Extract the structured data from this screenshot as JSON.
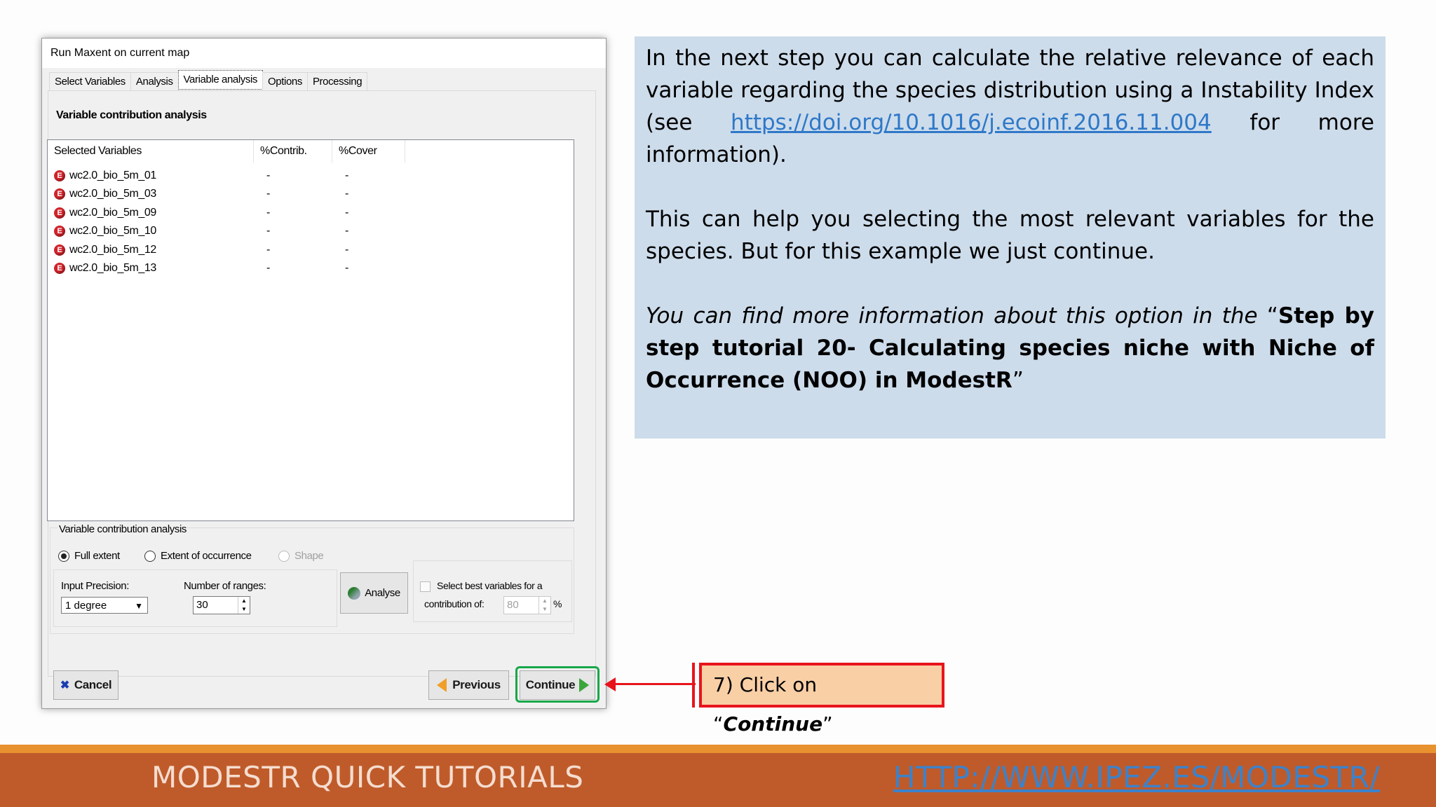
{
  "dialog": {
    "title": "Run Maxent on current map",
    "tabs": [
      "Select Variables",
      "Analysis",
      "Variable analysis",
      "Options",
      "Processing"
    ],
    "section_title": "Variable contribution analysis",
    "columns": [
      "Selected Variables",
      "%Contrib.",
      "%Cover"
    ],
    "rows": [
      {
        "name": "wc2.0_bio_5m_01",
        "contrib": "-",
        "cover": "-"
      },
      {
        "name": "wc2.0_bio_5m_03",
        "contrib": "-",
        "cover": "-"
      },
      {
        "name": "wc2.0_bio_5m_09",
        "contrib": "-",
        "cover": "-"
      },
      {
        "name": "wc2.0_bio_5m_10",
        "contrib": "-",
        "cover": "-"
      },
      {
        "name": "wc2.0_bio_5m_12",
        "contrib": "-",
        "cover": "-"
      },
      {
        "name": "wc2.0_bio_5m_13",
        "contrib": "-",
        "cover": "-"
      }
    ],
    "row_icon_letter": "E",
    "group_label": "Variable contribution analysis",
    "radios": {
      "full_extent": "Full extent",
      "extent_occurrence": "Extent of occurrence",
      "shape": "Shape"
    },
    "input_precision_label": "Input Precision:",
    "input_precision_value": "1 degree",
    "ranges_label": "Number of ranges:",
    "ranges_value": "30",
    "analyse_label": "Analyse",
    "select_best_line1": "Select best variables for a",
    "select_best_line2": "contribution of:",
    "select_best_value": "80",
    "percent_sign": "%",
    "cancel_label": "Cancel",
    "previous_label": "Previous",
    "continue_label": "Continue"
  },
  "info": {
    "p1_before": "In the next step you can calculate the relative relevance of each variable regarding the species distribution using a Instability Index (see ",
    "p1_link": "https://doi.org/10.1016/j.ecoinf.2016.11.004",
    "p1_after": " for more information).",
    "p2": "This can help you selecting the most relevant variables for the species. But for this example we just continue.",
    "p3_italic": "You can find more information about this option in the ",
    "p3_open_quote": "“",
    "p3_bold": "Step by step tutorial 20- Calculating  species niche with Niche of Occurrence (NOO) in ModestR",
    "p3_close_quote": "”"
  },
  "callout": {
    "prefix": "7) Click on “",
    "emphasis": "Continue",
    "suffix": "”"
  },
  "footer": {
    "title": "MODESTR QUICK TUTORIALS",
    "link": "HTTP://WWW.IPEZ.ES/MODESTR/"
  }
}
